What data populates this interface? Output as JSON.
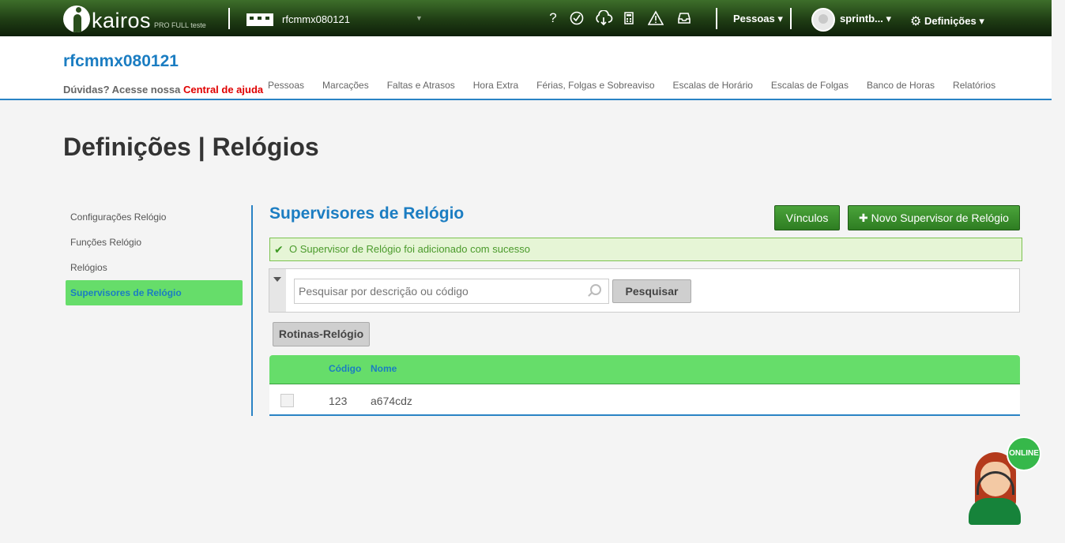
{
  "topbar": {
    "logo_text": "kairos",
    "logo_sub": "PRO FULL teste",
    "company": "rfcmmx080121",
    "icons": [
      "help-icon",
      "clock-check-icon",
      "cloud-download-icon",
      "calculator-icon",
      "warning-icon",
      "inbox-icon"
    ],
    "pessoas_label": "Pessoas",
    "user_label": "sprintb...",
    "settings_label": "Definições"
  },
  "header": {
    "company_title": "rfcmmx080121",
    "help_prefix": "Dúvidas? Acesse nossa",
    "help_link": "Central de ajuda",
    "nav": [
      "Pessoas",
      "Marcações",
      "Faltas e Atrasos",
      "Hora Extra",
      "Férias, Folgas e Sobreaviso",
      "Escalas de Horário",
      "Escalas de Folgas",
      "Banco de Horas",
      "Relatórios"
    ]
  },
  "page_title": "Definições | Relógios",
  "sidebar": {
    "items": [
      {
        "label": "Configurações Relógio"
      },
      {
        "label": "Funções Relógio"
      },
      {
        "label": "Relógios"
      },
      {
        "label": "Supervisores de Relógio"
      }
    ],
    "active_index": 3
  },
  "main": {
    "title": "Supervisores de Relógio",
    "vinculos_label": "Vínculos",
    "novo_label": "Novo Supervisor de Relógio",
    "alert_text": "O Supervisor de Relógio foi adicionado com sucesso",
    "search_placeholder": "Pesquisar por descrição ou código",
    "search_button": "Pesquisar",
    "rotinas_button": "Rotinas-Relógio",
    "table": {
      "headers": [
        "Código",
        "Nome"
      ],
      "rows": [
        {
          "codigo": "123",
          "nome": "a674cdz"
        }
      ]
    }
  },
  "online_widget": {
    "label": "ONLINE"
  },
  "colors": {
    "topbar_green": "#1f3d14",
    "accent_blue": "#1b7dc2",
    "active_green": "#66dd6a",
    "button_green": "#2e7d22",
    "help_red": "#e00000"
  }
}
